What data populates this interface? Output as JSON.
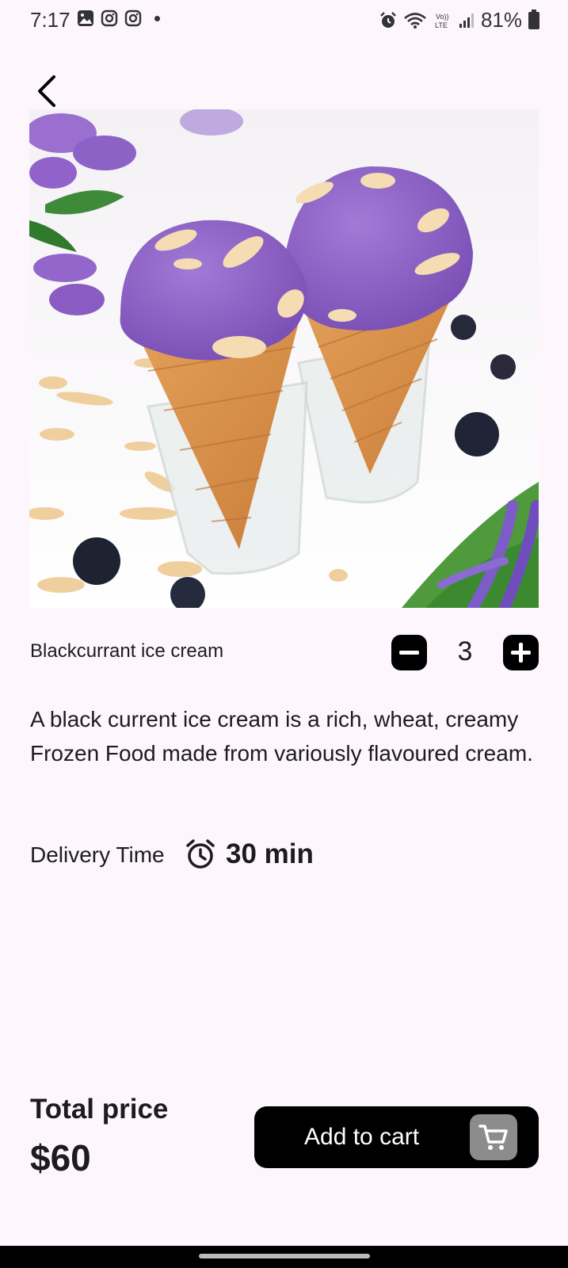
{
  "status_bar": {
    "time": "7:17",
    "left_icons": [
      "gallery-icon",
      "instagram-icon",
      "instagram-icon",
      "notification-dot-icon"
    ],
    "right_icons": [
      "alarm-icon",
      "wifi-icon",
      "volte-icon",
      "signal-icon",
      "battery-icon"
    ],
    "battery": "81%"
  },
  "header": {
    "back_icon": "chevron-left-icon"
  },
  "product": {
    "image_alt": "Two purple ice cream cones in glasses with coconut flakes, blueberries and lavender",
    "name": "Blackcurrant ice cream",
    "quantity": "3",
    "description": "A black current ice cream is a rich, wheat, creamy Frozen Food made from variously flavoured cream."
  },
  "delivery": {
    "label": "Delivery Time",
    "icon": "alarm-clock-icon",
    "value": "30 min"
  },
  "footer": {
    "total_label": "Total price",
    "total_value": "$60",
    "cart_button_label": "Add to cart",
    "cart_icon": "cart-icon"
  },
  "colors": {
    "background": "#fdf7fd",
    "button": "#000000",
    "cart_icon_bg": "#8c8c8c",
    "ice_cream": "#8e62c4"
  }
}
